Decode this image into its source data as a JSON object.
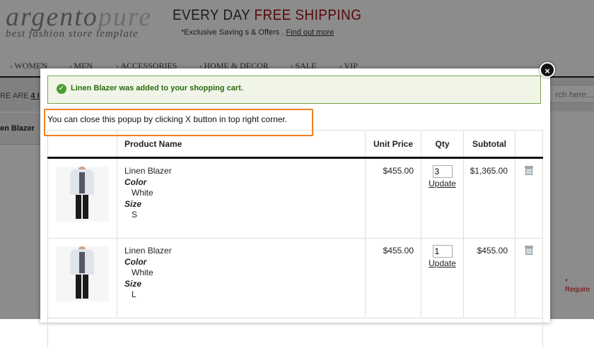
{
  "header": {
    "logo_main": "argento",
    "logo_accent": "pure",
    "logo_tagline": "best fashion store template",
    "promo_title_plain": "EVERY DAY ",
    "promo_title_red": "FREE SHIPPING",
    "promo_sub_text": "*Exclusive Saving s & Offers . ",
    "promo_sub_link": "Find out more"
  },
  "nav": {
    "items": [
      "WOMEN",
      "MEN",
      "ACCESSORIES",
      "HOME & DECOR",
      "SALE",
      "VIP"
    ]
  },
  "breadcrumb": {
    "prefix": "RE ARE ",
    "link": "4 I"
  },
  "search": {
    "placeholder": "rch here..."
  },
  "sidebar": {
    "label": "en Blazer"
  },
  "required_note": "* Require",
  "popup": {
    "close_label": "×",
    "success_message": "Linen Blazer was added to your shopping cart.",
    "hint_text": "You can close this popup by clicking X button in top right corner.",
    "table": {
      "headers": [
        "",
        "Product Name",
        "Unit Price",
        "Qty",
        "Subtotal",
        ""
      ],
      "rows": [
        {
          "name": "Linen Blazer",
          "color_label": "Color",
          "color_value": "White",
          "size_label": "Size",
          "size_value": "S",
          "unit_price": "$455.00",
          "qty": "3",
          "update_label": "Update",
          "subtotal": "$1,365.00"
        },
        {
          "name": "Linen Blazer",
          "color_label": "Color",
          "color_value": "White",
          "size_label": "Size",
          "size_value": "L",
          "unit_price": "$455.00",
          "qty": "1",
          "update_label": "Update",
          "subtotal": "$455.00"
        }
      ]
    }
  },
  "colors": {
    "accent_red": "#a50d14",
    "success_green": "#2b6a0e",
    "hint_border": "#f07f21"
  }
}
